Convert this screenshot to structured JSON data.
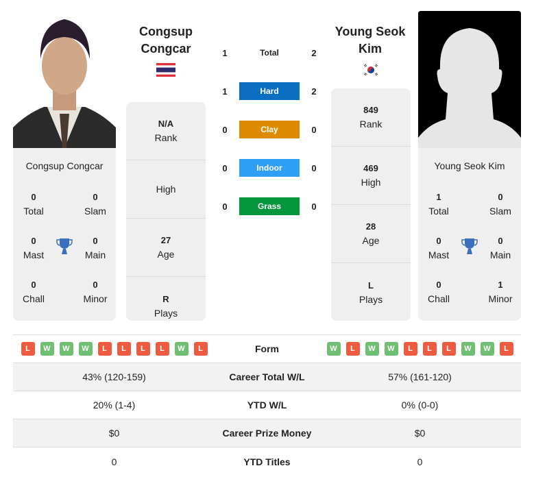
{
  "colors": {
    "hard": "#0a6fc2",
    "clay": "#dd8c00",
    "indoor": "#2f9ff5",
    "grass": "#03963a",
    "win": "#6fbf73",
    "loss": "#ee5b40",
    "trophy": "#3a6fbf"
  },
  "player1": {
    "name": "Congsup Congcar",
    "name_line1": "Congsup",
    "name_line2": "Congcar",
    "flag_icon": "thailand-flag-icon",
    "titles": {
      "total": {
        "value": "0",
        "label": "Total"
      },
      "slam": {
        "value": "0",
        "label": "Slam"
      },
      "mast": {
        "value": "0",
        "label": "Mast"
      },
      "main": {
        "value": "0",
        "label": "Main"
      },
      "chall": {
        "value": "0",
        "label": "Chall"
      },
      "minor": {
        "value": "0",
        "label": "Minor"
      }
    },
    "stats": [
      {
        "value": "N/A",
        "label": "Rank"
      },
      {
        "value": "",
        "label": "High"
      },
      {
        "value": "27",
        "label": "Age"
      },
      {
        "value": "R",
        "label": "Plays"
      }
    ],
    "form": [
      "L",
      "W",
      "W",
      "W",
      "L",
      "L",
      "L",
      "L",
      "W",
      "L"
    ]
  },
  "player2": {
    "name": "Young Seok Kim",
    "name_line1": "Young Seok",
    "name_line2": "Kim",
    "flag_icon": "south-korea-flag-icon",
    "titles": {
      "total": {
        "value": "1",
        "label": "Total"
      },
      "slam": {
        "value": "0",
        "label": "Slam"
      },
      "mast": {
        "value": "0",
        "label": "Mast"
      },
      "main": {
        "value": "0",
        "label": "Main"
      },
      "chall": {
        "value": "0",
        "label": "Chall"
      },
      "minor": {
        "value": "1",
        "label": "Minor"
      }
    },
    "stats": [
      {
        "value": "849",
        "label": "Rank"
      },
      {
        "value": "469",
        "label": "High"
      },
      {
        "value": "28",
        "label": "Age"
      },
      {
        "value": "L",
        "label": "Plays"
      }
    ],
    "form": [
      "W",
      "L",
      "W",
      "W",
      "L",
      "L",
      "L",
      "W",
      "W",
      "L"
    ]
  },
  "h2h": [
    {
      "label": "Total",
      "p1": "1",
      "p2": "2",
      "surface": "total"
    },
    {
      "label": "Hard",
      "p1": "1",
      "p2": "2",
      "surface": "hard"
    },
    {
      "label": "Clay",
      "p1": "0",
      "p2": "0",
      "surface": "clay"
    },
    {
      "label": "Indoor",
      "p1": "0",
      "p2": "0",
      "surface": "indoor"
    },
    {
      "label": "Grass",
      "p1": "0",
      "p2": "0",
      "surface": "grass"
    }
  ],
  "table": {
    "form_label": "Form",
    "rows": [
      {
        "label": "Career Total W/L",
        "p1": "43% (120-159)",
        "p2": "57% (161-120)"
      },
      {
        "label": "YTD W/L",
        "p1": "20% (1-4)",
        "p2": "0% (0-0)"
      },
      {
        "label": "Career Prize Money",
        "p1": "$0",
        "p2": "$0"
      },
      {
        "label": "YTD Titles",
        "p1": "0",
        "p2": "0"
      }
    ]
  }
}
